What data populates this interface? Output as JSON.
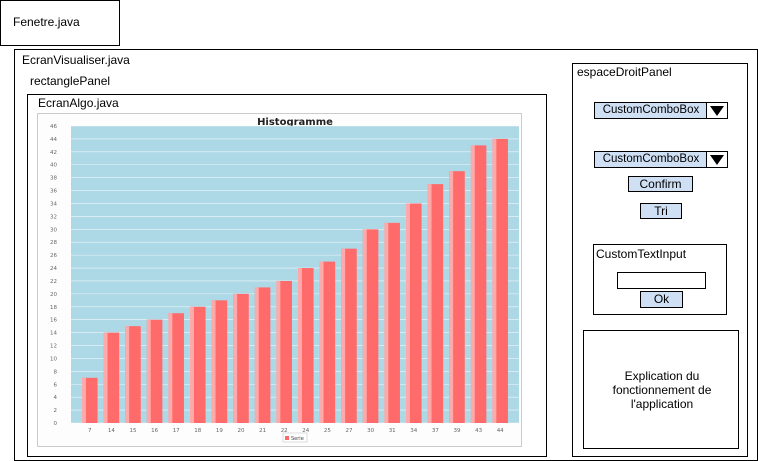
{
  "labels": {
    "fenetre": "Fenetre.java",
    "ecran_visualiser": "EcranVisualiser.java",
    "rectangle_panel": "rectanglePanel",
    "ecran_algo": "EcranAlgo.java",
    "espace_droit": "espaceDroitPanel"
  },
  "controls": {
    "combo1": "CustomComboBox",
    "combo2": "CustomComboBox",
    "confirm": "Confirm",
    "tri": "Tri",
    "text_input_title": "CustomTextInput",
    "text_input_value": "",
    "ok": "Ok",
    "explication": "Explication du fonctionnement de l'application"
  },
  "colors": {
    "bar": "#ff6b6b",
    "bar_highlight": "#ffc4c4",
    "plot_bg": "#add8e6",
    "control_bg": "#cfe0f4"
  },
  "chart_data": {
    "type": "bar",
    "title": "Histogramme",
    "categories": [
      "7",
      "14",
      "15",
      "16",
      "17",
      "18",
      "19",
      "20",
      "21",
      "22",
      "24",
      "25",
      "27",
      "30",
      "31",
      "34",
      "37",
      "39",
      "43",
      "44"
    ],
    "series": [
      {
        "name": "Serie",
        "values": [
          7,
          14,
          15,
          16,
          17,
          18,
          19,
          20,
          21,
          22,
          24,
          25,
          27,
          30,
          31,
          34,
          37,
          39,
          43,
          44
        ]
      }
    ],
    "yticks": [
      0,
      2,
      4,
      6,
      8,
      10,
      12,
      14,
      16,
      18,
      20,
      22,
      24,
      26,
      28,
      30,
      32,
      34,
      36,
      38,
      40,
      42,
      44,
      46
    ],
    "ylim": [
      0,
      46
    ],
    "grid": true,
    "legend": "bottom-center"
  }
}
